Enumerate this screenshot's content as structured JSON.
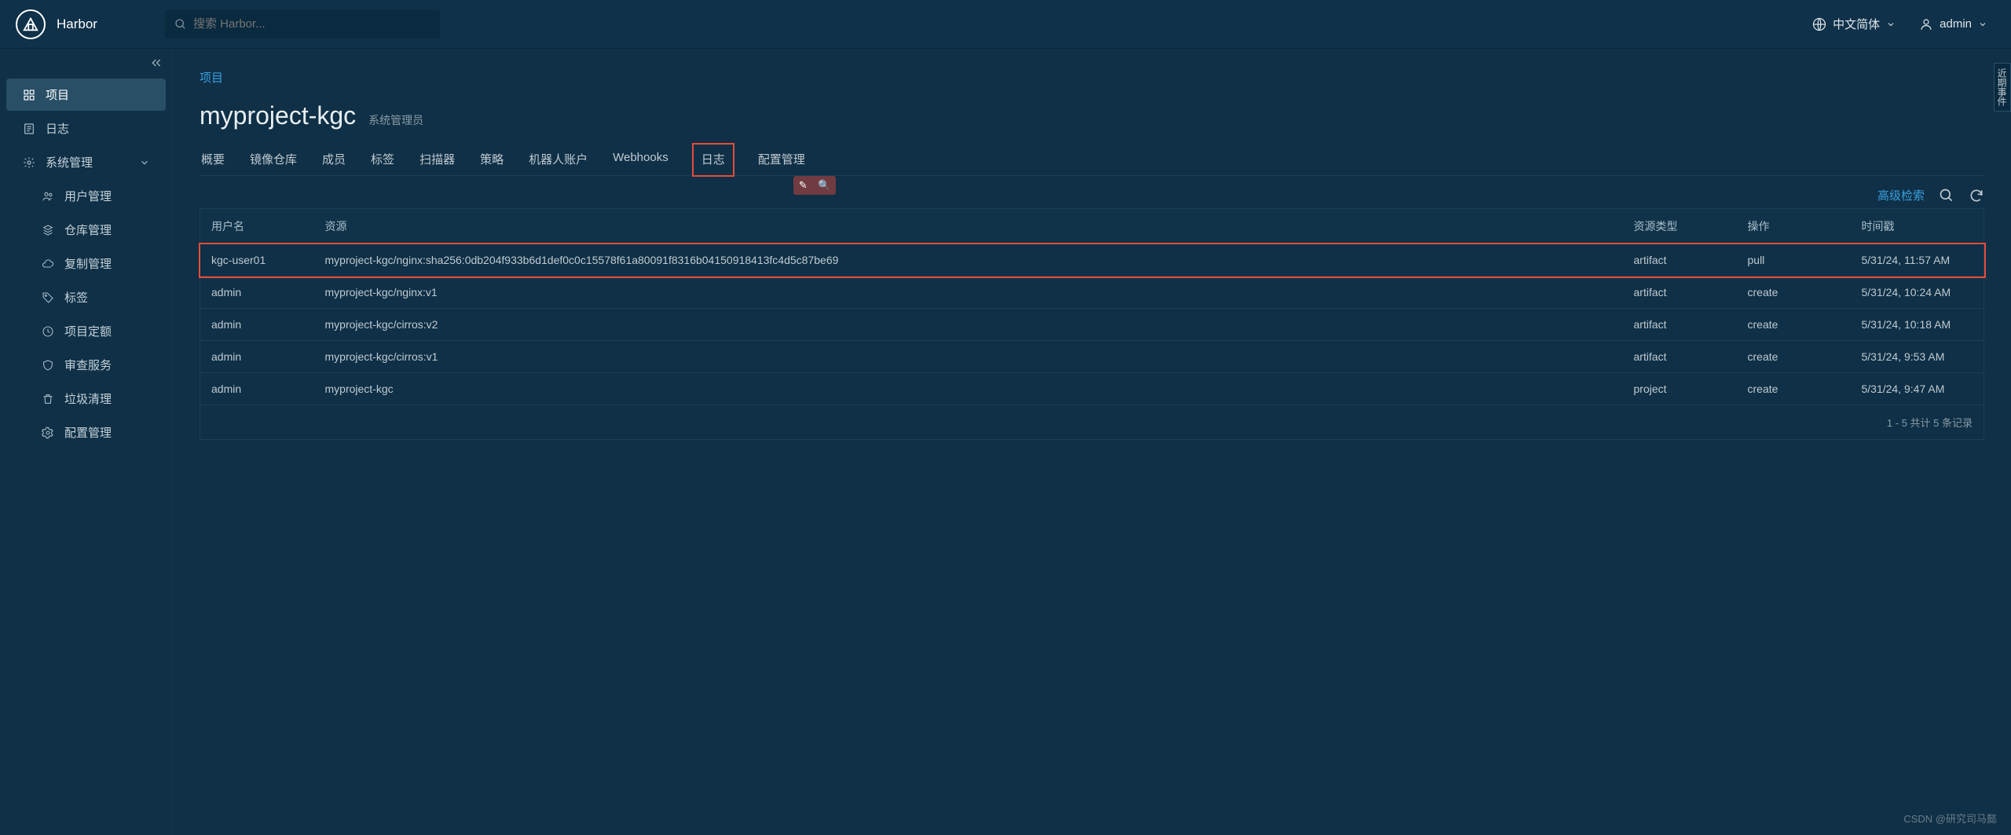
{
  "header": {
    "brand": "Harbor",
    "search_placeholder": "搜索 Harbor...",
    "language": "中文简体",
    "user": "admin"
  },
  "sidebar": {
    "items": [
      {
        "label": "项目",
        "active": true
      },
      {
        "label": "日志"
      },
      {
        "label": "系统管理",
        "group": true
      }
    ],
    "admin_sub": [
      {
        "label": "用户管理"
      },
      {
        "label": "仓库管理"
      },
      {
        "label": "复制管理"
      },
      {
        "label": "标签"
      },
      {
        "label": "项目定额"
      },
      {
        "label": "审查服务"
      },
      {
        "label": "垃圾清理"
      },
      {
        "label": "配置管理"
      }
    ]
  },
  "breadcrumb": "项目",
  "project": {
    "name": "myproject-kgc",
    "role": "系统管理员"
  },
  "tabs": [
    {
      "label": "概要"
    },
    {
      "label": "镜像仓库"
    },
    {
      "label": "成员"
    },
    {
      "label": "标签"
    },
    {
      "label": "扫描器"
    },
    {
      "label": "策略"
    },
    {
      "label": "机器人账户"
    },
    {
      "label": "Webhooks"
    },
    {
      "label": "日志",
      "highlighted": true
    },
    {
      "label": "配置管理"
    }
  ],
  "toolbar": {
    "advanced_search": "高级检索"
  },
  "table": {
    "headers": {
      "user": "用户名",
      "resource": "资源",
      "resource_type": "资源类型",
      "operation": "操作",
      "timestamp": "时间戳"
    },
    "rows": [
      {
        "user": "kgc-user01",
        "resource": "myproject-kgc/nginx:sha256:0db204f933b6d1def0c0c15578f61a80091f8316b04150918413fc4d5c87be69",
        "resource_type": "artifact",
        "operation": "pull",
        "timestamp": "5/31/24, 11:57 AM",
        "highlight": true
      },
      {
        "user": "admin",
        "resource": "myproject-kgc/nginx:v1",
        "resource_type": "artifact",
        "operation": "create",
        "timestamp": "5/31/24, 10:24 AM"
      },
      {
        "user": "admin",
        "resource": "myproject-kgc/cirros:v2",
        "resource_type": "artifact",
        "operation": "create",
        "timestamp": "5/31/24, 10:18 AM"
      },
      {
        "user": "admin",
        "resource": "myproject-kgc/cirros:v1",
        "resource_type": "artifact",
        "operation": "create",
        "timestamp": "5/31/24, 9:53 AM"
      },
      {
        "user": "admin",
        "resource": "myproject-kgc",
        "resource_type": "project",
        "operation": "create",
        "timestamp": "5/31/24, 9:47 AM"
      }
    ],
    "footer": "1 - 5 共计 5 条记录"
  },
  "side_panel": "近期事件",
  "watermark": "CSDN @研究司马懿"
}
